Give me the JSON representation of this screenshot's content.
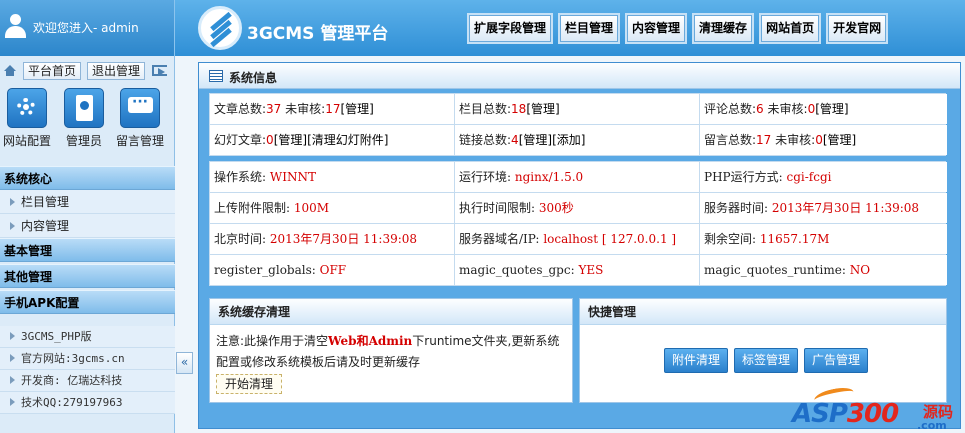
{
  "header": {
    "welcome": "欢迎您进入- admin",
    "brand": "3GCMS 管理平台",
    "nav": [
      "扩展字段管理",
      "栏目管理",
      "内容管理",
      "清理缓存",
      "网站首页",
      "开发官网"
    ]
  },
  "sidebar": {
    "home_btn": "平台首页",
    "logout_btn": "退出管理",
    "shortcuts": [
      "网站配置",
      "管理员",
      "留言管理"
    ],
    "groups": [
      {
        "title": "系统核心",
        "items": [
          "栏目管理",
          "内容管理"
        ]
      },
      {
        "title": "基本管理",
        "items": []
      },
      {
        "title": "其他管理",
        "items": []
      },
      {
        "title": "手机APK配置",
        "items": []
      }
    ],
    "info": [
      "3GCMS_PHP版",
      "官方网站:3gcms.cn",
      "开发商: 亿瑞达科技",
      "技术QQ:279197963"
    ],
    "collapse": "«"
  },
  "system": {
    "title": "系统信息",
    "stats": {
      "articles_label": "文章总数:",
      "articles": "37",
      "articles_pending_label": "未审核:",
      "articles_pending": "17",
      "columns_label": "栏目总数:",
      "columns": "18",
      "comments_label": "评论总数:",
      "comments": "6",
      "comments_pending_label": "未审核:",
      "comments_pending": "0",
      "slides_label": "幻灯文章:",
      "slides": "0",
      "links_label": "链接总数:",
      "links": "4",
      "messages_label": "留言总数:",
      "messages": "17",
      "messages_pending_label": "未审核:",
      "messages_pending": "0",
      "manage": "[管理]",
      "clear_slides": "[清理幻灯附件]",
      "add": "[添加]"
    },
    "env": {
      "os_label": "操作系统:",
      "os": "WINNT",
      "runtime_label": "运行环境:",
      "runtime": "nginx/1.5.0",
      "php_mode_label": "PHP运行方式:",
      "php_mode": "cgi-fcgi",
      "upload_label": "上传附件限制:",
      "upload": "100M",
      "exec_label": "执行时间限制:",
      "exec": "300秒",
      "server_time_label": "服务器时间:",
      "server_time": "2013年7月30日 11:39:08",
      "bj_time_label": "北京时间:",
      "bj_time": "2013年7月30日 11:39:08",
      "host_label": "服务器域名/IP:",
      "host": "localhost [ 127.0.0.1 ]",
      "space_label": "剩余空间:",
      "space": "11657.17M",
      "rg_label": "register_globals:",
      "rg": "OFF",
      "mqg_label": "magic_quotes_gpc:",
      "mqg": "YES",
      "mqr_label": "magic_quotes_runtime:",
      "mqr": "NO"
    }
  },
  "cache": {
    "title": "系统缓存清理",
    "note_prefix": "注意:此操作用于清空",
    "note_web": "Web",
    "note_and": "和",
    "note_admin": "Admin",
    "note_suffix": "下runtime文件夹,更新系统配置或修改系统模板后请及时更新缓存",
    "button": "开始清理"
  },
  "quick": {
    "title": "快捷管理",
    "buttons": [
      "附件清理",
      "标签管理",
      "广告管理"
    ]
  },
  "watermark": {
    "asp": "ASP",
    "num": "300",
    "ym": "源码",
    "com": ".com"
  },
  "colors": {
    "accent": "#2f8fd6",
    "value_red": "#d40000"
  }
}
